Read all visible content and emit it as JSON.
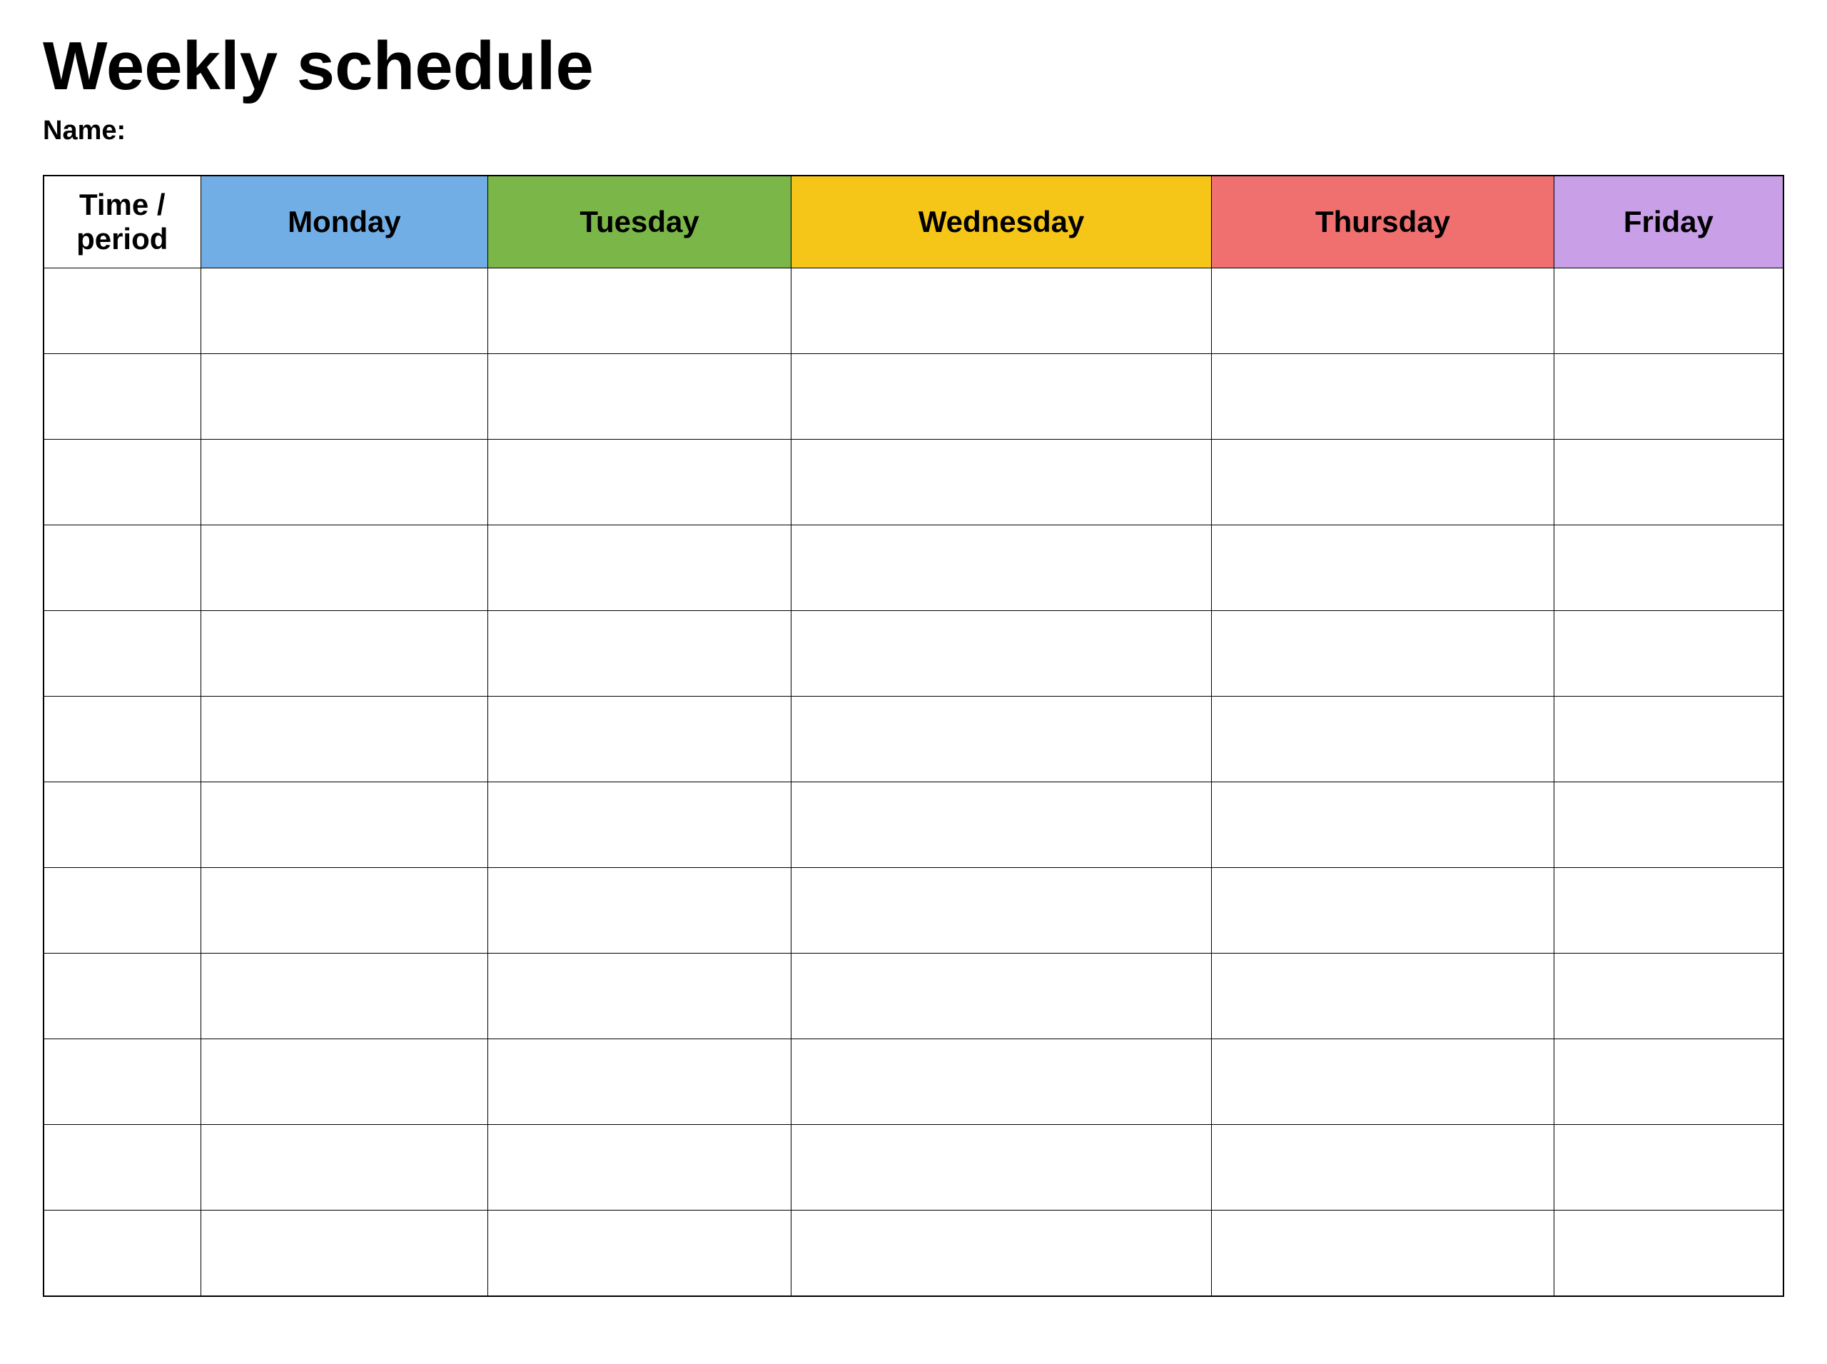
{
  "page": {
    "title": "Weekly schedule",
    "name_label": "Name:",
    "table": {
      "headers": {
        "time_period": "Time / period",
        "monday": "Monday",
        "tuesday": "Tuesday",
        "wednesday": "Wednesday",
        "thursday": "Thursday",
        "friday": "Friday"
      },
      "row_count": 12
    }
  }
}
